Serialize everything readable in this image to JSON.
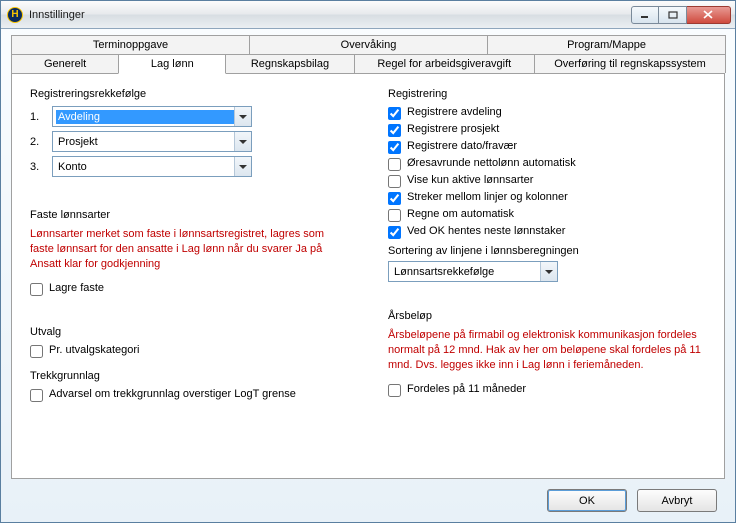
{
  "window": {
    "title": "Innstillinger"
  },
  "tabsTop": {
    "termin": "Terminoppgave",
    "overvaking": "Overvåking",
    "program": "Program/Mappe"
  },
  "tabsBottom": {
    "generelt": "Generelt",
    "laglonn": "Lag lønn",
    "regnskap": "Regnskapsbilag",
    "regel": "Regel for arbeidsgiveravgift",
    "overforing": "Overføring til regnskapssystem"
  },
  "left": {
    "regOrderTitle": "Registreringsrekkefølge",
    "n1": "1.",
    "n2": "2.",
    "n3": "3.",
    "order1": "Avdeling",
    "order2": "Prosjekt",
    "order3": "Konto",
    "fasteTitle": "Faste lønnsarter",
    "fasteHint": "Lønnsarter merket som faste i lønnsartsregistret, lagres som faste lønnsart for den ansatte i Lag lønn når du svarer Ja på Ansatt klar for godkjenning",
    "lagreFaste": "Lagre faste",
    "utvalgTitle": "Utvalg",
    "utvalgCheck": "Pr. utvalgskategori",
    "trekkTitle": "Trekkgrunnlag",
    "trekkCheck": "Advarsel om trekkgrunnlag overstiger LogT grense"
  },
  "right": {
    "regTitle": "Registrering",
    "chkAvdeling": "Registrere avdeling",
    "chkProsjekt": "Registrere  prosjekt",
    "chkDato": "Registrere  dato/fravær",
    "chkOres": "Øresavrunde nettolønn automatisk",
    "chkVise": "Vise kun aktive lønnsarter",
    "chkStreker": "Streker mellom linjer og kolonner",
    "chkRegne": "Regne om automatisk",
    "chkVedOk": "Ved OK hentes neste lønnstaker",
    "sortTitle": "Sortering av linjene i lønnsberegningen",
    "sortValue": "Lønnsartsrekkefølge",
    "arsTitle": "Årsbeløp",
    "arsHint": "Årsbeløpene på firmabil og elektronisk kommunikasjon fordeles normalt på 12 mnd.  Hak av her om beløpene skal fordeles på 11 mnd. Dvs. legges ikke inn i Lag lønn i feriemåneden.",
    "chkFordeles": "Fordeles på 11 måneder"
  },
  "footer": {
    "ok": "OK",
    "avbryt": "Avbryt"
  }
}
